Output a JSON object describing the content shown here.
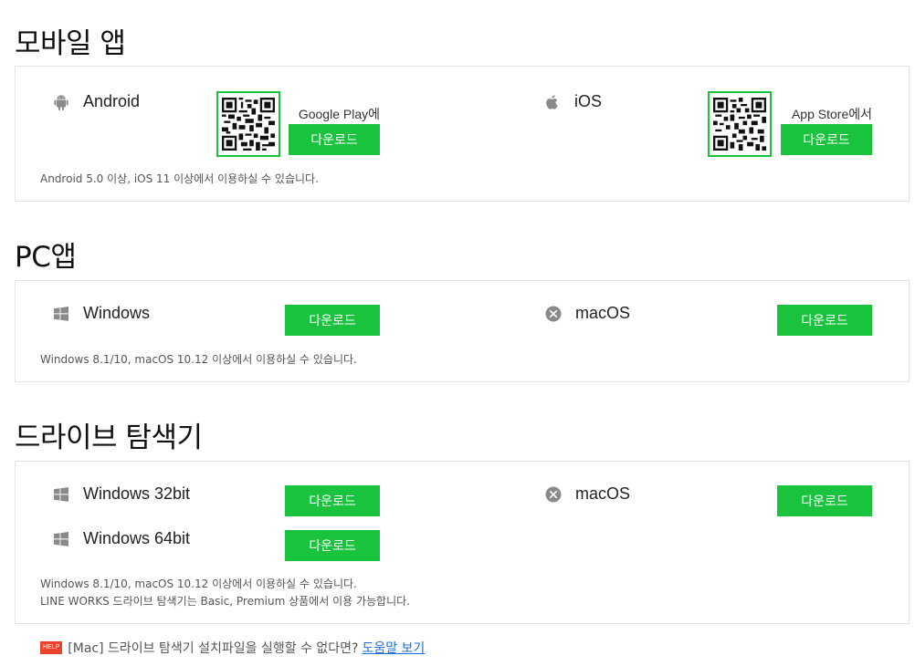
{
  "sections": {
    "mobile": {
      "title": "모바일 앱",
      "android": {
        "name": "Android",
        "store_label": "Google Play에서",
        "button": "다운로드",
        "icon": "android-icon"
      },
      "ios": {
        "name": "iOS",
        "store_label": "App Store에서",
        "button": "다운로드",
        "icon": "apple-icon"
      },
      "note": "Android 5.0 이상, iOS 11 이상에서 이용하실 수 있습니다."
    },
    "pc": {
      "title": "PC앱",
      "windows": {
        "name": "Windows",
        "button": "다운로드",
        "icon": "windows-icon"
      },
      "macos": {
        "name": "macOS",
        "button": "다운로드",
        "icon": "macos-icon"
      },
      "note": "Windows 8.1/10, macOS 10.12 이상에서 이용하실 수 있습니다."
    },
    "drive": {
      "title": "드라이브 탐색기",
      "win32": {
        "name": "Windows 32bit",
        "button": "다운로드",
        "icon": "windows-icon"
      },
      "win64": {
        "name": "Windows 64bit",
        "button": "다운로드",
        "icon": "windows-icon"
      },
      "macos": {
        "name": "macOS",
        "button": "다운로드",
        "icon": "macos-icon"
      },
      "note1": "Windows 8.1/10, macOS 10.12 이상에서 이용하실 수 있습니다.",
      "note2": "LINE WORKS 드라이브 탐색기는 Basic, Premium 상품에서 이용 가능합니다."
    }
  },
  "help": {
    "badge": "HELP",
    "text": "[Mac] 드라이브 탐색기 설치파일을 실행할 수 없다면?",
    "link": "도움말 보기"
  },
  "colors": {
    "accent": "#19c33e",
    "help_badge": "#e8452c",
    "link": "#1f6fd6"
  }
}
